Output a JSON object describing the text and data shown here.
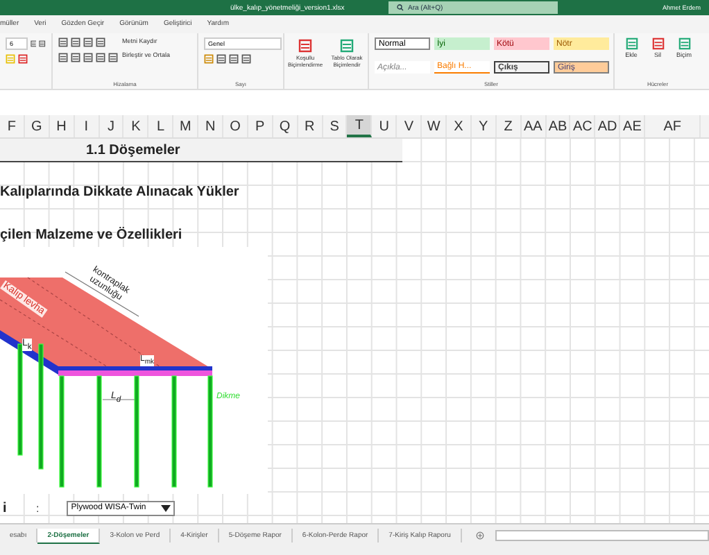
{
  "window": {
    "title": "ülke_kalıp_yönetmeliği_version1.xlsx",
    "search": "Ara (Alt+Q)",
    "user": "Ahmet Erdem"
  },
  "ribbon_tabs": [
    {
      "label": "müller",
      "selected": false
    },
    {
      "label": "Veri",
      "selected": false
    },
    {
      "label": "Gözden Geçir",
      "selected": false
    },
    {
      "label": "Görünüm",
      "selected": false
    },
    {
      "label": "Geliştirici",
      "selected": false
    },
    {
      "label": "Yardım",
      "selected": false
    }
  ],
  "ribbon": {
    "font_size": "6",
    "wrap_text": "Metni Kaydır",
    "merge": "Birleştir ve Ortala",
    "alignment_group": "Hizalama",
    "number_format": "Genel",
    "number_group": "Sayı",
    "conditional": "Koşullu Biçimlendirme",
    "format_table": "Tablo Olarak Biçimlendir",
    "styles": [
      {
        "label": "Normal",
        "kind": "normal"
      },
      {
        "label": "İyi",
        "kind": "good"
      },
      {
        "label": "Kötü",
        "kind": "bad"
      },
      {
        "label": "Nötr",
        "kind": "neutral"
      },
      {
        "label": "Açıkla...",
        "kind": "explanatory"
      },
      {
        "label": "Bağlı H...",
        "kind": "linked"
      },
      {
        "label": "Çıkış",
        "kind": "output"
      },
      {
        "label": "Giriş",
        "kind": "input"
      }
    ],
    "styles_group": "Stiller",
    "cells": [
      {
        "label": "Ekle",
        "kind": "insert"
      },
      {
        "label": "Sil",
        "kind": "delete"
      },
      {
        "label": "Biçim",
        "kind": "format"
      }
    ],
    "cells_group": "Hücreler"
  },
  "columns": [
    {
      "label": "F",
      "selected": false
    },
    {
      "label": "G",
      "selected": false
    },
    {
      "label": "H",
      "selected": false
    },
    {
      "label": "I",
      "selected": false
    },
    {
      "label": "J",
      "selected": false
    },
    {
      "label": "K",
      "selected": false
    },
    {
      "label": "L",
      "selected": false
    },
    {
      "label": "M",
      "selected": false
    },
    {
      "label": "N",
      "selected": false
    },
    {
      "label": "O",
      "selected": false
    },
    {
      "label": "P",
      "selected": false
    },
    {
      "label": "Q",
      "selected": false
    },
    {
      "label": "R",
      "selected": false
    },
    {
      "label": "S",
      "selected": false
    },
    {
      "label": "T",
      "selected": true
    },
    {
      "label": "U",
      "selected": false
    },
    {
      "label": "V",
      "selected": false
    },
    {
      "label": "W",
      "selected": false
    },
    {
      "label": "X",
      "selected": false
    },
    {
      "label": "Y",
      "selected": false
    },
    {
      "label": "Z",
      "selected": false
    },
    {
      "label": "AA",
      "selected": false
    },
    {
      "label": "AB",
      "selected": false
    },
    {
      "label": "AC",
      "selected": false
    },
    {
      "label": "AD",
      "selected": false
    },
    {
      "label": "AE",
      "selected": false
    },
    {
      "label": "AF",
      "selected": false
    }
  ],
  "sheet": {
    "title": "1.1 Döşemeler",
    "heading_1": "Kalıplarında Dikkate Alınacak Yükler",
    "heading_2": "çilen Malzeme ve Özellikleri",
    "drawing_labels": {
      "length": "kontraplak uzunluğu",
      "panel": "Kalıp levha",
      "span_k": "L$_{k}$",
      "span_mk": "L$_{mk}$",
      "span_d": "L$_{d}$",
      "post": "Dikme"
    },
    "form": {
      "label": "i",
      "separator": ":",
      "value": "Plywood WISA-Twin"
    }
  },
  "sheet_tabs": [
    {
      "label": "esabı",
      "selected": false
    },
    {
      "label": "2-Döşemeler",
      "selected": true
    },
    {
      "label": "3-Kolon ve Perd",
      "selected": false
    },
    {
      "label": "4-Kirişler",
      "selected": false
    },
    {
      "label": "5-Döşeme Rapor",
      "selected": false
    },
    {
      "label": "6-Kolon-Perde Rapor",
      "selected": false
    },
    {
      "label": "7-Kiriş Kalıp Raporu",
      "selected": false
    }
  ]
}
